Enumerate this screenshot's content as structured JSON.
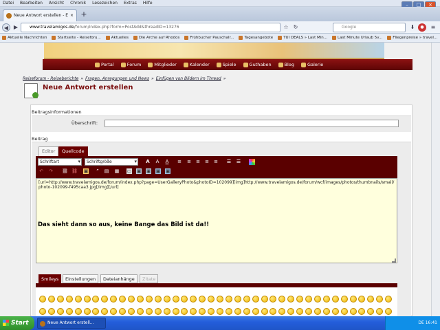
{
  "menubar": [
    "Datei",
    "Bearbeiten",
    "Ansicht",
    "Chronik",
    "Lesezeichen",
    "Extras",
    "Hilfe"
  ],
  "tab": {
    "title": "Neue Antwort erstellen - Einf..."
  },
  "navbar": {
    "url_host": "www.travelamigos.de",
    "url_rest": "/forum/index.php?form=PostAdd&threadID=13276",
    "search_placeholder": "Google"
  },
  "bookmarks": [
    "Aktuelle Nachrichten",
    "Startseite - Reiseforu...",
    "Aktuelles",
    "Die Arche auf Rhodos",
    "Frühbucher Pauschalr...",
    "Tagesangebote",
    "TUI DEALS » Last Min...",
    "Last Minute Urlaub 5v...",
    "Fliegenpreise » travel..."
  ],
  "nav": [
    "Portal",
    "Forum",
    "Mitglieder",
    "Kalender",
    "Spiele",
    "Guthaben",
    "Blog",
    "Galerie"
  ],
  "breadcrumb": [
    "Reiseforum - Reiseberichte",
    "»",
    "Fragen, Anregungen und News",
    "»",
    "Einfügen von Bildern im Thread",
    "»"
  ],
  "page_title": "Neue Antwort erstellen",
  "post_info": {
    "legend": "Beitragsinformationen",
    "heading_label": "Überschrift:"
  },
  "post": {
    "legend": "Beitrag",
    "tabs": [
      "Editor",
      "Quellcode"
    ],
    "font_select": "Schriftart",
    "size_select": "Schriftgröße",
    "source": "[url=http://www.travelamigos.de/forum/index.php?page=UserGalleryPhoto&photoID=102099][img]http://www.travelamigos.de/forum/wcf/images/photos/thumbnails/small/photo-102099-f495caa3.jpg[/img][/url]",
    "message": "Das sieht dann so aus, keine Bange das Bild ist da!!"
  },
  "bottom_tabs": [
    "Smileys",
    "Einstellungen",
    "Dateianhänge",
    "Zitate"
  ],
  "taskbar": {
    "start": "Start",
    "item": "Neue Antwort erstell...",
    "tray": "DE  16:41"
  }
}
